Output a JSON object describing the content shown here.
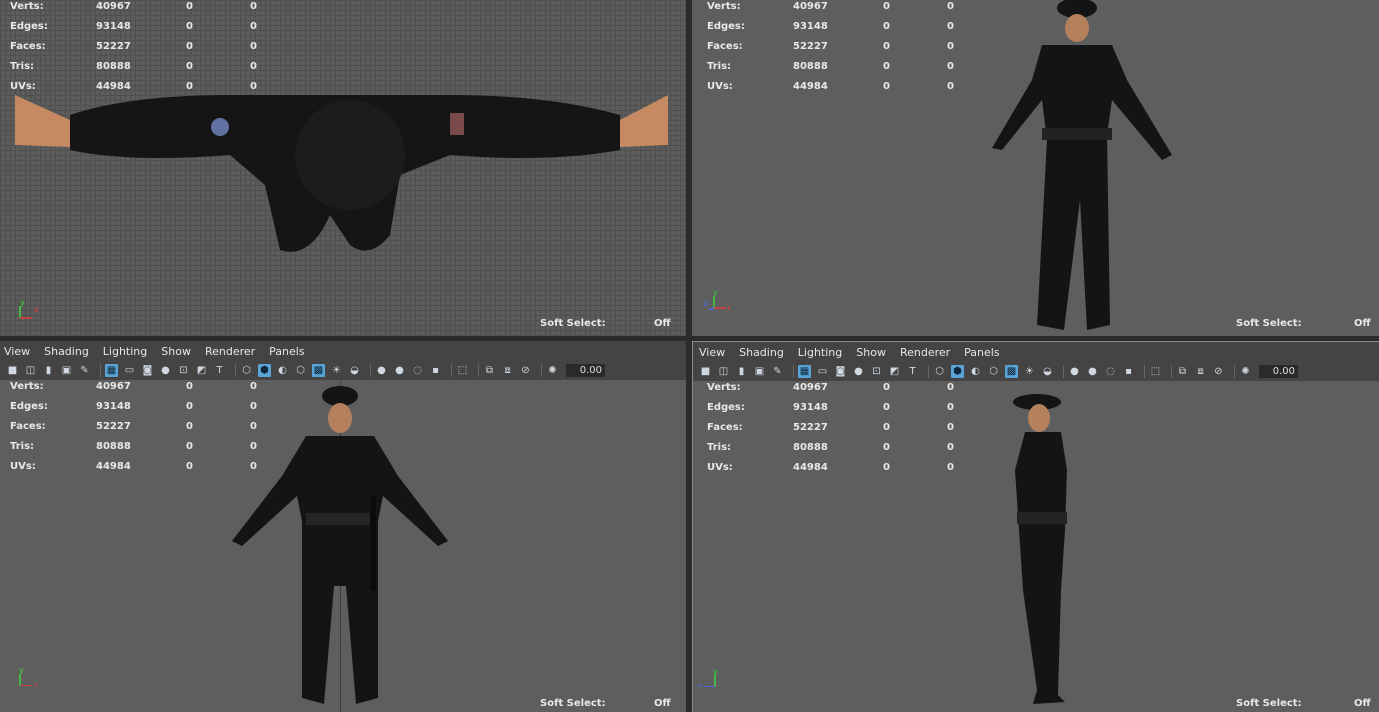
{
  "stats": {
    "labels": [
      "Verts:",
      "Edges:",
      "Faces:",
      "Tris:",
      "UVs:"
    ],
    "values": [
      "40967",
      "93148",
      "52227",
      "80888",
      "44984"
    ],
    "zeros": "0"
  },
  "soft_select": {
    "label": "Soft Select:",
    "value": "Off"
  },
  "menu": {
    "view": "View",
    "shading": "Shading",
    "lighting": "Lighting",
    "show": "Show",
    "renderer": "Renderer",
    "panels": "Panels"
  },
  "toolbar": {
    "field_value": "0.00"
  },
  "axis": {
    "x": "x",
    "y": "y",
    "z": "z"
  },
  "colors": {
    "viewport_bg": "#5e5e5e",
    "grid_line": "#4f4f4f",
    "accent_button": "#5aa3d6",
    "axis_x": "#e23b3b",
    "axis_y": "#3bd43b",
    "axis_z": "#4a6bff"
  }
}
